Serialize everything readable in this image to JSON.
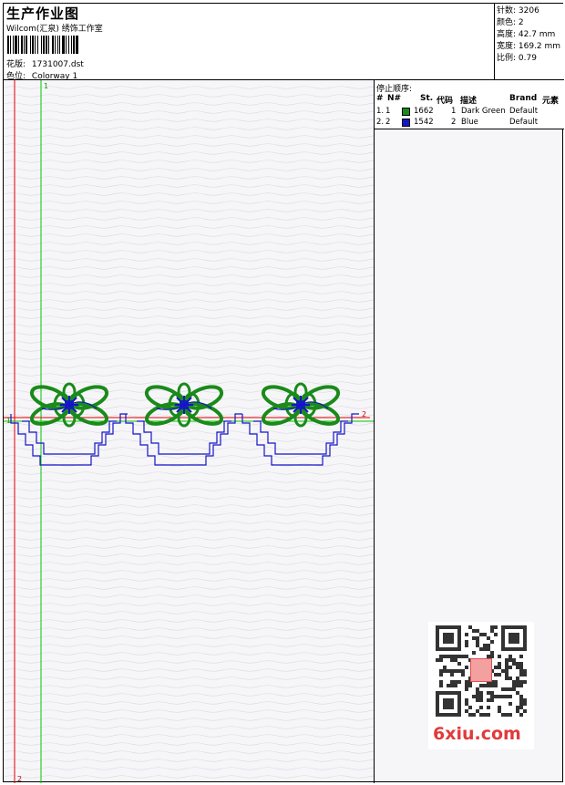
{
  "header": {
    "title": "生产作业图",
    "company": "Wilcom(汇泉) 绣饰工作室",
    "design_label": "花版:",
    "design_value": "1731007.dst",
    "colorway_label": "色位:",
    "colorway_value": "Colorway 1"
  },
  "specs": {
    "stitches": "针数: 3206",
    "colors": "颜色: 2",
    "height": "高度: 42.7 mm",
    "width": "宽度: 169.2 mm",
    "scale": "比例: 0.79"
  },
  "stop_sequence": {
    "title": "停止顺序:",
    "columns": [
      "#",
      "N#",
      "St.",
      "代码",
      "描述",
      "Brand",
      "元素"
    ],
    "rows": [
      {
        "index": "1.",
        "n": "1",
        "color": "#1a8a1a",
        "stitches": "1662",
        "code": "1",
        "description": "Dark Green",
        "brand": "Default"
      },
      {
        "index": "2.",
        "n": "2",
        "color": "#1414c8",
        "stitches": "1542",
        "code": "2",
        "description": "Blue",
        "brand": "Default"
      }
    ]
  },
  "canvas": {
    "marker_left_top": "1",
    "marker_left_mid": "1",
    "marker_right_mid": "2",
    "marker_bottom": "2"
  },
  "colors": {
    "thread_green": "#1a8a1a",
    "thread_blue": "#1414c8",
    "guide_green": "#00c800",
    "guide_red": "#e00000"
  },
  "watermark": {
    "text": "6xiu.com"
  }
}
